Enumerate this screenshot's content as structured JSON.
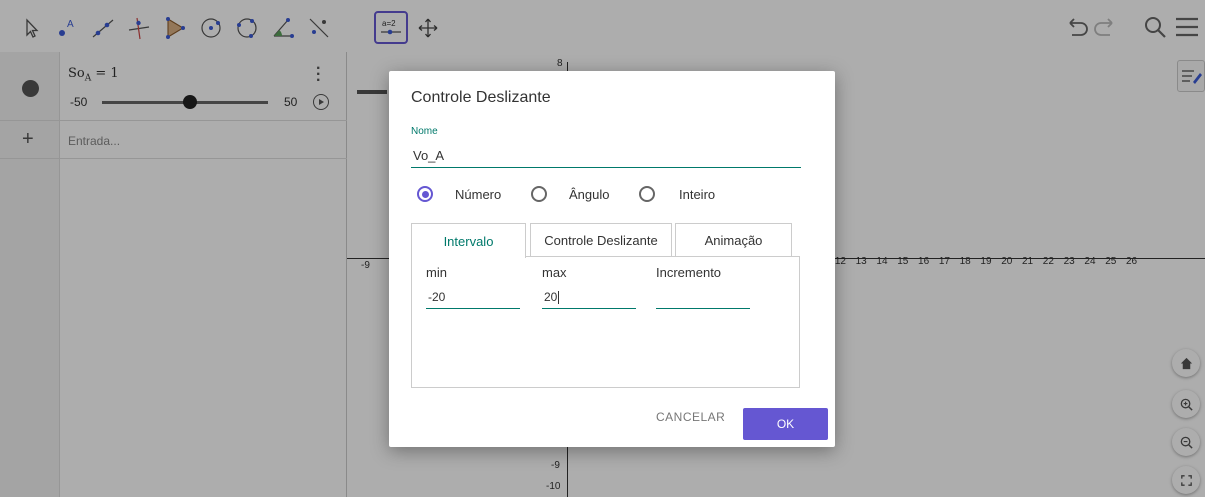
{
  "toolbar": {
    "tools": [
      {
        "name": "move-tool-icon",
        "selected": false
      },
      {
        "name": "point-tool-icon",
        "selected": false
      },
      {
        "name": "line-tool-icon",
        "selected": false
      },
      {
        "name": "perpendicular-line-tool-icon",
        "selected": false
      },
      {
        "name": "polygon-tool-icon",
        "selected": false
      },
      {
        "name": "circle-center-point-tool-icon",
        "selected": false
      },
      {
        "name": "circle-three-points-tool-icon",
        "selected": false
      },
      {
        "name": "angle-tool-icon",
        "selected": false
      },
      {
        "name": "reflect-tool-icon",
        "selected": false
      },
      {
        "name": "slider-tool-icon",
        "selected": true
      },
      {
        "name": "move-graphics-view-tool-icon",
        "selected": false
      }
    ],
    "slider_icon_text": "a=2",
    "right": [
      "undo-icon",
      "redo-icon",
      "search-icon",
      "menu-icon"
    ]
  },
  "algebra": {
    "var_main": "So",
    "var_sub": "A",
    "eq_value": " = 1",
    "slider_min": "-50",
    "slider_max": "50",
    "slider_value": 1,
    "input_placeholder": "Entrada..."
  },
  "graphics": {
    "x_ticks": [
      "12",
      "13",
      "14",
      "15",
      "16",
      "17",
      "18",
      "19",
      "20",
      "21",
      "22",
      "23",
      "24",
      "25",
      "26"
    ],
    "x_tick_left": "-9",
    "y_tick_top": "8",
    "y_tick_m9": "-9",
    "y_tick_m10": "-10"
  },
  "dialog": {
    "title": "Controle Deslizante",
    "name_label": "Nome",
    "name_value": "Vo_A",
    "radio_options": [
      "Número",
      "Ângulo",
      "Inteiro"
    ],
    "radio_selected": "Número",
    "tabs": [
      "Intervalo",
      "Controle Deslizante",
      "Animação"
    ],
    "active_tab": "Intervalo",
    "fields": {
      "min_label": "min",
      "min_value": "-20",
      "max_label": "max",
      "max_value": "20",
      "increment_label": "Incremento",
      "increment_value": ""
    },
    "cancel_label": "CANCELAR",
    "ok_label": "OK"
  },
  "colors": {
    "accent": "#6557d2",
    "teal": "#00796b"
  }
}
